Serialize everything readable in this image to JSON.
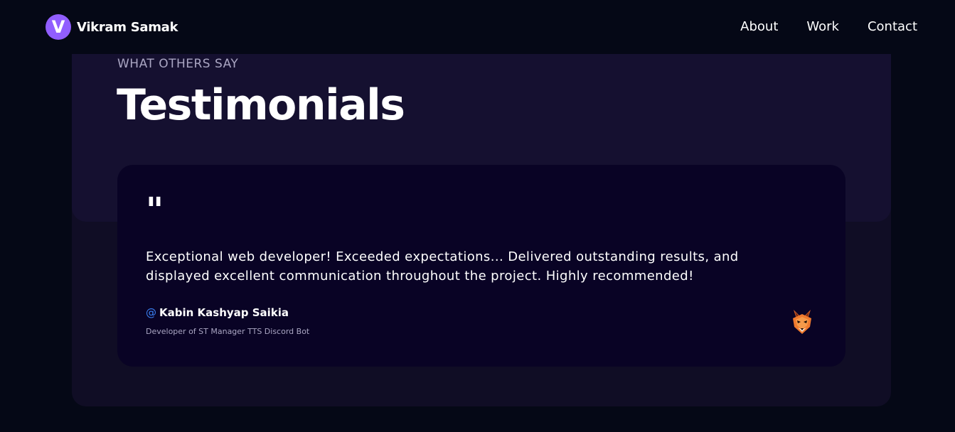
{
  "brand": {
    "logo_letter": "V",
    "name": "Vikram Samak"
  },
  "nav": {
    "links": [
      "About",
      "Work",
      "Contact"
    ]
  },
  "section": {
    "subtitle": "WHAT OTHERS SAY",
    "title": "Testimonials"
  },
  "testimonial": {
    "quote_mark": "\"",
    "text": "Exceptional web developer! Exceeded expectations... Delivered outstanding results, and displayed excellent communication throughout the project. Highly recommended!",
    "at_symbol": "@",
    "author": "Kabin Kashyap Saikia",
    "role": "Developer of ST Manager TTS Discord Bot",
    "avatar_icon": "fox-avatar-icon"
  },
  "colors": {
    "background": "#050816",
    "accent": "#915eff",
    "card": "#090325",
    "panel": "#151030",
    "secondary_text": "#aaa6c3",
    "at_blue": "#3b82f6"
  }
}
